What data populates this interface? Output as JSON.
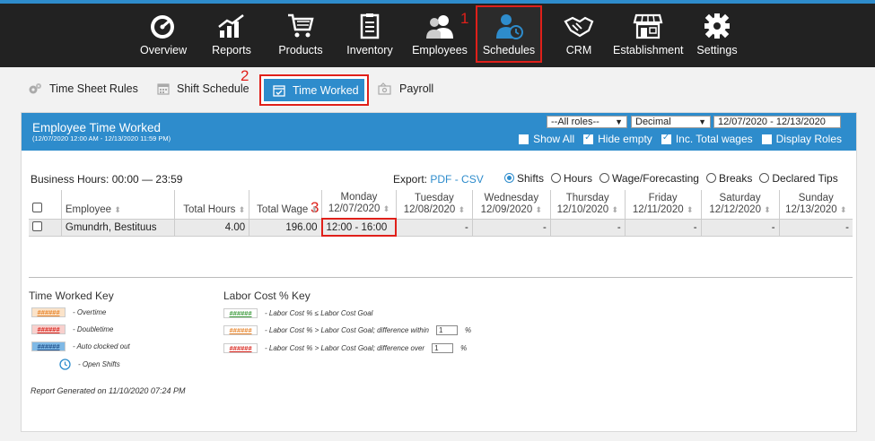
{
  "nav": {
    "items": [
      {
        "label": "Overview",
        "icon": "gauge-icon"
      },
      {
        "label": "Reports",
        "icon": "chart-icon"
      },
      {
        "label": "Products",
        "icon": "cart-icon"
      },
      {
        "label": "Inventory",
        "icon": "clipboard-icon"
      },
      {
        "label": "Employees",
        "icon": "people-icon"
      },
      {
        "label": "Schedules",
        "icon": "person-clock-icon"
      },
      {
        "label": "CRM",
        "icon": "handshake-icon"
      },
      {
        "label": "Establishment",
        "icon": "store-icon"
      },
      {
        "label": "Settings",
        "icon": "gear-icon"
      }
    ],
    "active": "Schedules"
  },
  "annotations": {
    "a1": "1",
    "a2": "2",
    "a3": "3"
  },
  "subtabs": {
    "time_sheet_rules": "Time Sheet Rules",
    "shift_schedule": "Shift Schedule",
    "time_worked": "Time Worked",
    "payroll": "Payroll"
  },
  "panel": {
    "title": "Employee Time Worked",
    "subtitle": "(12/07/2020 12:00 AM - 12/13/2020 11:59 PM)",
    "roles_select": "--All roles--",
    "format_select": "Decimal",
    "date_range": "12/07/2020 - 12/13/2020",
    "show_all": "Show All",
    "hide_empty": "Hide empty",
    "inc_total_wages": "Inc. Total wages",
    "display_roles": "Display Roles"
  },
  "business_hours": "Business Hours: 00:00 — 23:59",
  "export": {
    "label": "Export:",
    "pdf": "PDF",
    "sep": "-",
    "csv": "CSV"
  },
  "view_modes": [
    "Shifts",
    "Hours",
    "Wage/Forecasting",
    "Breaks",
    "Declared Tips"
  ],
  "table": {
    "headers": {
      "employee": "Employee",
      "total_hours": "Total Hours",
      "total_wage": "Total Wage",
      "days": [
        {
          "day": "Monday",
          "date": "12/07/2020"
        },
        {
          "day": "Tuesday",
          "date": "12/08/2020"
        },
        {
          "day": "Wednesday",
          "date": "12/09/2020"
        },
        {
          "day": "Thursday",
          "date": "12/10/2020"
        },
        {
          "day": "Friday",
          "date": "12/11/2020"
        },
        {
          "day": "Saturday",
          "date": "12/12/2020"
        },
        {
          "day": "Sunday",
          "date": "12/13/2020"
        }
      ]
    },
    "rows": [
      {
        "employee": "Gmundrh, Bestituus",
        "total_hours": "4.00",
        "total_wage": "196.00",
        "days": [
          "12:00 - 16:00",
          "-",
          "-",
          "-",
          "-",
          "-",
          "-"
        ]
      }
    ]
  },
  "time_worked_key": {
    "title": "Time Worked Key",
    "items": [
      {
        "swatch": "######",
        "label": "- Overtime",
        "color": "#e8842a",
        "bg": "#fbe3c9"
      },
      {
        "swatch": "######",
        "label": "- Doubletime",
        "color": "#d9231b",
        "bg": "#f8d0cd"
      },
      {
        "swatch": "######",
        "label": "- Auto clocked out",
        "color": "#1f4f8a",
        "bg": "#7fb9e6"
      }
    ],
    "open_shifts": "- Open Shifts"
  },
  "labor_cost_key": {
    "title": "Labor Cost % Key",
    "items": [
      {
        "swatch": "######",
        "label": "- Labor Cost % ≤ Labor Cost Goal",
        "color": "#3a9a3a"
      },
      {
        "swatch": "######",
        "label": "- Labor Cost % > Labor Cost Goal; difference within",
        "color": "#e8842a",
        "box": "1",
        "unit": "%"
      },
      {
        "swatch": "######",
        "label": "- Labor Cost % > Labor Cost Goal; difference over",
        "color": "#d9231b",
        "box": "1",
        "unit": "%"
      }
    ]
  },
  "report_generated": "Report Generated on 11/10/2020 07:24 PM",
  "colors": {
    "accent": "#2e8ccc",
    "annotation": "#e0201a",
    "nav_bg": "#222222"
  }
}
